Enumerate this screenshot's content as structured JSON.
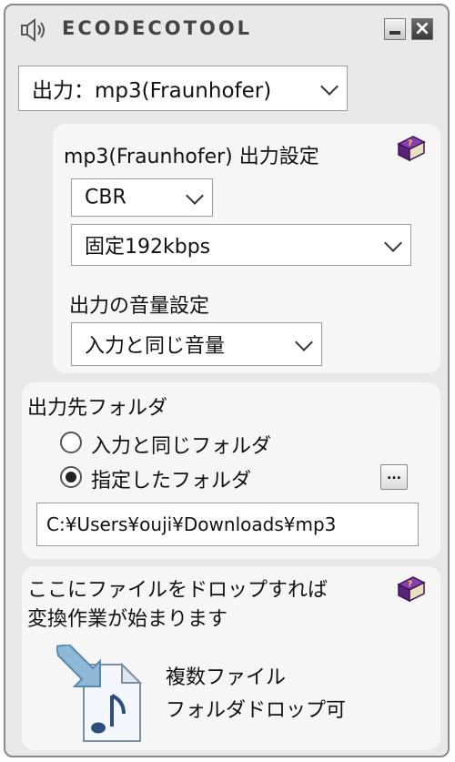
{
  "window": {
    "title": "ECODECOTOOL"
  },
  "output_select": {
    "value": "出力：mp3(Fraunhofer)"
  },
  "settings_panel": {
    "heading": "mp3(Fraunhofer) 出力設定",
    "mode": "CBR",
    "bitrate": "固定192kbps",
    "volume_label": "出力の音量設定",
    "volume": "入力と同じ音量"
  },
  "folder_panel": {
    "heading": "出力先フォルダ",
    "option_same": "入力と同じフォルダ",
    "option_custom": "指定したフォルダ",
    "selected": "custom",
    "browse": "...",
    "path": "C:¥Users¥ouji¥Downloads¥mp3"
  },
  "drop_panel": {
    "line1": "ここにファイルをドロップすれば",
    "line2": "変換作業が始まります",
    "note1": "複数ファイル",
    "note2": "フォルダドロップ可"
  },
  "icons": {
    "speaker": "speaker-icon",
    "help": "help-book-icon",
    "drop": "music-file-drop-icon"
  },
  "colors": {
    "window_bg": "#e9e9e9",
    "panel_bg": "#f6f6f6",
    "book_purple": "#6a2d8f",
    "arrow_blue": "#6aa0c8"
  }
}
